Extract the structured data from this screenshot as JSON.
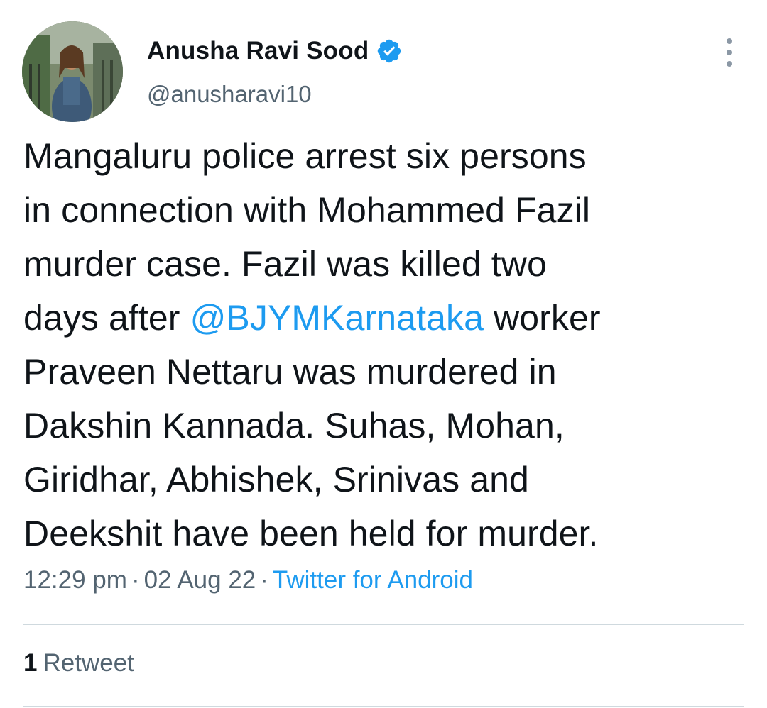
{
  "author": {
    "display_name": "Anusha Ravi Sood",
    "handle": "@anusharavi10",
    "verified": true,
    "avatar_icon": "profile-photo",
    "verified_icon": "verified-badge-icon",
    "menu_icon": "more-vertical-icon"
  },
  "tweet": {
    "lines": [
      {
        "before": "Mangaluru police arrest six persons",
        "mention": "",
        "after": ""
      },
      {
        "before": "in connection with Mohammed Fazil",
        "mention": "",
        "after": ""
      },
      {
        "before": "murder case. Fazil was killed two",
        "mention": "",
        "after": ""
      },
      {
        "before": "days after ",
        "mention": "@BJYMKarnataka",
        "after": " worker"
      },
      {
        "before": "Praveen Nettaru was murdered in",
        "mention": "",
        "after": ""
      },
      {
        "before": "Dakshin Kannada. Suhas, Mohan,",
        "mention": "",
        "after": ""
      },
      {
        "before": "Giridhar, Abhishek, Srinivas and",
        "mention": "",
        "after": ""
      },
      {
        "before": "Deekshit have been held for murder.",
        "mention": "",
        "after": ""
      }
    ]
  },
  "meta": {
    "time": "12:29 pm",
    "separator": "·",
    "date": "02 Aug 22",
    "source": "Twitter for Android"
  },
  "stats": {
    "retweet_count": "1",
    "retweet_label": "Retweet"
  },
  "colors": {
    "text": "#0f1419",
    "secondary": "#536471",
    "accent": "#1d9bf0",
    "divider": "#cfd9de"
  }
}
